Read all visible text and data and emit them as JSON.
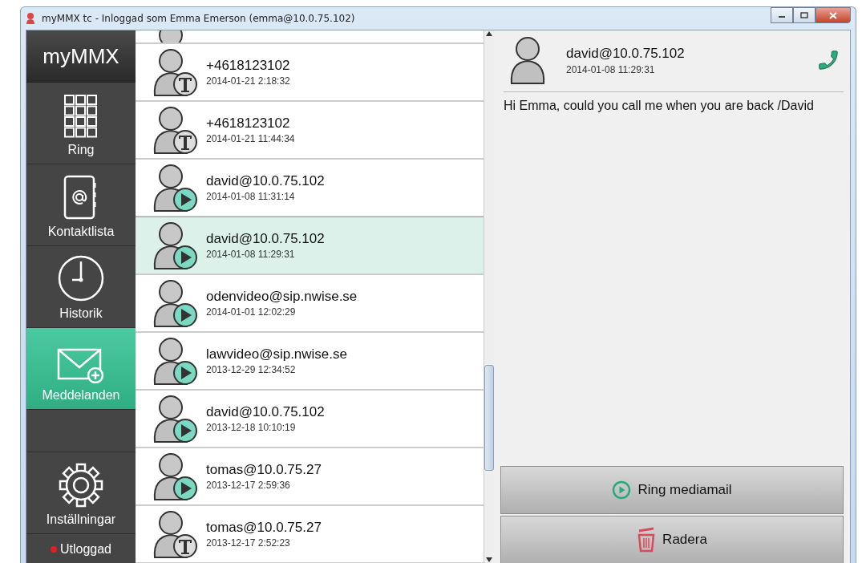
{
  "window": {
    "title": "myMMX tc - Inloggad som Emma Emerson (emma@10.0.75.102)"
  },
  "sidebar": {
    "logo": "myMMX",
    "items": [
      {
        "kind": "dialpad",
        "label": "Ring",
        "selected": false
      },
      {
        "kind": "contacts",
        "label": "Kontaktlista",
        "selected": false
      },
      {
        "kind": "history",
        "label": "Historik",
        "selected": false
      },
      {
        "kind": "messages",
        "label": "Meddelanden",
        "selected": true
      },
      {
        "kind": "spacer"
      },
      {
        "kind": "settings",
        "label": "Inställningar",
        "selected": false
      }
    ],
    "status": {
      "label": "Utloggad",
      "color": "#e02020"
    }
  },
  "messages": [
    {
      "kind": "text",
      "from": "+4618123102",
      "time": "2014-01-21 2:18:32",
      "selected": false
    },
    {
      "kind": "text",
      "from": "+4618123102",
      "time": "2014-01-21 11:44:34",
      "selected": false
    },
    {
      "kind": "video",
      "from": "david@10.0.75.102",
      "time": "2014-01-08 11:31:14",
      "selected": false
    },
    {
      "kind": "video",
      "from": "david@10.0.75.102",
      "time": "2014-01-08 11:29:31",
      "selected": true
    },
    {
      "kind": "video",
      "from": "odenvideo@sip.nwise.se",
      "time": "2014-01-01 12:02:29",
      "selected": false
    },
    {
      "kind": "video",
      "from": "lawvideo@sip.nwise.se",
      "time": "2013-12-29 12:34:52",
      "selected": false
    },
    {
      "kind": "video",
      "from": "david@10.0.75.102",
      "time": "2013-12-18 10:10:19",
      "selected": false
    },
    {
      "kind": "video",
      "from": "tomas@10.0.75.27",
      "time": "2013-12-17 2:59:36",
      "selected": false
    },
    {
      "kind": "text",
      "from": "tomas@10.0.75.27",
      "time": "2013-12-17 2:52:23",
      "selected": false
    }
  ],
  "detail": {
    "from": "david@10.0.75.102",
    "time": "2014-01-08 11:29:31",
    "body": "Hi Emma, could you call me when you are back /David",
    "buttons": [
      {
        "kind": "play",
        "label": "Ring mediamail"
      },
      {
        "kind": "delete",
        "label": "Radera"
      }
    ]
  }
}
